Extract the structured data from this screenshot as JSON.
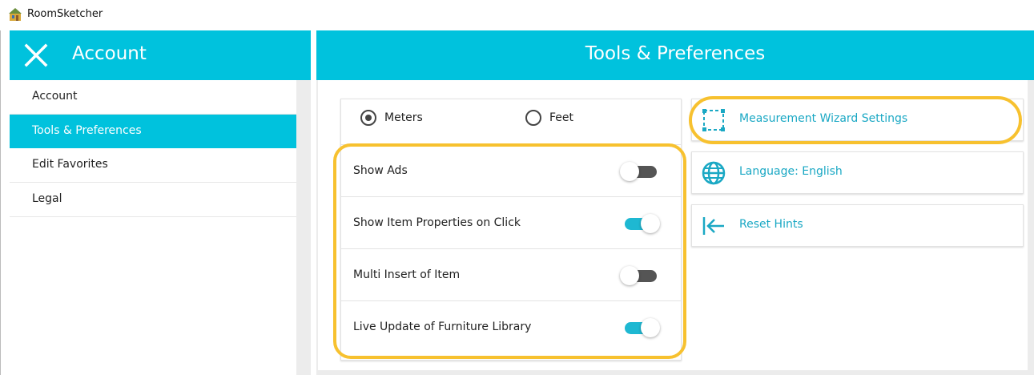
{
  "window": {
    "title": "RoomSketcher"
  },
  "sidebar": {
    "header_title": "Account",
    "items": [
      {
        "label": "Account",
        "active": false
      },
      {
        "label": "Tools & Preferences",
        "active": true
      },
      {
        "label": "Edit Favorites",
        "active": false
      },
      {
        "label": "Legal",
        "active": false
      }
    ]
  },
  "main": {
    "title": "Tools & Preferences",
    "units": {
      "options": [
        {
          "label": "Meters",
          "selected": true
        },
        {
          "label": "Feet",
          "selected": false
        }
      ]
    },
    "toggles": [
      {
        "label": "Show Ads",
        "on": false
      },
      {
        "label": "Show Item Properties on Click",
        "on": true
      },
      {
        "label": "Multi Insert of Item",
        "on": false
      },
      {
        "label": "Live Update of Furniture Library",
        "on": true
      }
    ],
    "options": [
      {
        "label": "Measurement Wizard Settings",
        "icon": "measurement-frame-icon"
      },
      {
        "label": "Language: English",
        "icon": "globe-icon"
      },
      {
        "label": "Reset Hints",
        "icon": "arrow-left-bar-icon"
      }
    ]
  },
  "colors": {
    "accent": "#00c2dd",
    "highlight": "#f7c12f",
    "link": "#1aa8c4",
    "toggle_on": "#1eb8d2",
    "toggle_off": "#555555"
  }
}
